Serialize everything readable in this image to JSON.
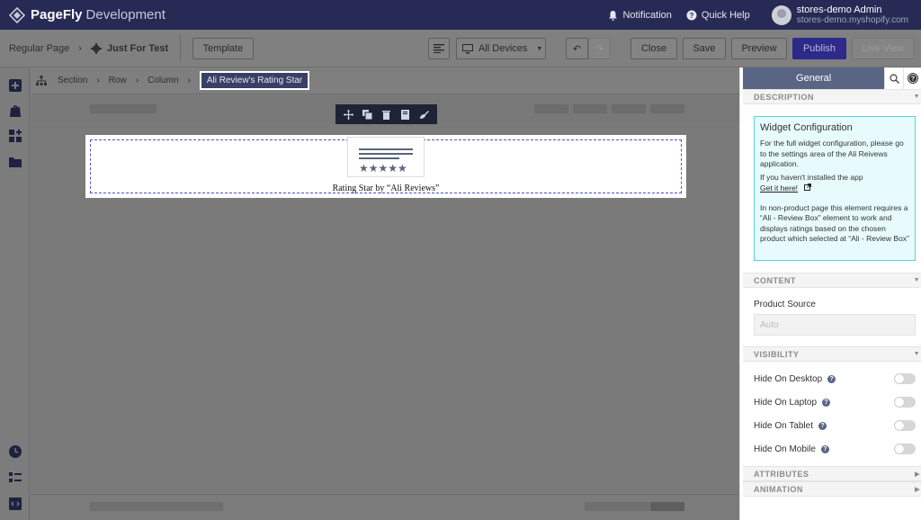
{
  "topbar": {
    "brand": "PageFly",
    "brand_suffix": "Development",
    "notification_label": "Notification",
    "quick_help_label": "Quick Help",
    "user_name": "stores-demo Admin",
    "user_shop": "stores-demo.myshopify.com"
  },
  "toolbar": {
    "page_type": "Regular Page",
    "page_name": "Just For Test",
    "template_label": "Template",
    "device_label": "All Devices",
    "close_label": "Close",
    "save_label": "Save",
    "preview_label": "Preview",
    "publish_label": "Publish",
    "live_view_label": "Live View"
  },
  "canvas_breadcrumb": {
    "items": [
      "Section",
      "Row",
      "Column"
    ],
    "active": "Ali Review's Rating Star"
  },
  "element": {
    "stars": "★★★★★",
    "label": "Rating Star by “Ali Reviews”"
  },
  "panel": {
    "tab_general": "General",
    "description_heading": "DESCRIPTION",
    "info_title": "Widget Configuration",
    "info_p1": "For the full widget configuration, please go to the settings area of the Ali Reivews application.",
    "info_p2": "If you haven't installed the app",
    "info_link": "Get it here!",
    "info_p3": "In non-product page this element requires a “Ali - Review Box” element to work and displays ratings based on the chosen product which selected at “Ali - Review Box”",
    "content_heading": "CONTENT",
    "product_source_label": "Product Source",
    "product_source_placeholder": "Auto",
    "visibility_heading": "VISIBILITY",
    "visibility_items": [
      "Hide On Desktop",
      "Hide On Laptop",
      "Hide On Tablet",
      "Hide On Mobile"
    ],
    "visibility_values": [
      false,
      false,
      false,
      false
    ],
    "attributes_heading": "ATTRIBUTES",
    "animation_heading": "ANIMATION"
  },
  "colors": {
    "topbar_bg": "#262a54",
    "publish_bg": "#2d2a8a",
    "tab_active_bg": "#596683",
    "info_bg": "#e8fbfc",
    "info_border": "#55d4dc",
    "selection_dash": "#4b55c8"
  }
}
